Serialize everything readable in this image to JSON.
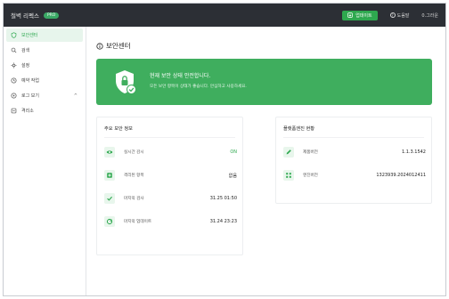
{
  "app": {
    "title": "철벽 리펙스",
    "badge": "PRO"
  },
  "topbar": {
    "update_label": "업데이트",
    "help_label": "도움말",
    "version_label": "0.그라운"
  },
  "sidebar": {
    "items": [
      {
        "label": "보안센터",
        "icon": "shield-icon",
        "active": true
      },
      {
        "label": "검색",
        "icon": "search-icon",
        "active": false
      },
      {
        "label": "설정",
        "icon": "gear-icon",
        "active": false
      },
      {
        "label": "예약 작업",
        "icon": "clock-icon",
        "active": false
      },
      {
        "label": "로그 보기",
        "icon": "log-icon",
        "active": false,
        "expandable": true
      },
      {
        "label": "격리소",
        "icon": "quarantine-icon",
        "active": false
      }
    ]
  },
  "main": {
    "title": "보안센터",
    "banner": {
      "title": "현재 보안 상태 안전합니다.",
      "description": "모든 보안 항목이 상태가 좋습니다. 안심하고 사용하세요."
    },
    "status_card": {
      "title": "주요 보안 정보",
      "rows": [
        {
          "icon": "eye-icon",
          "label": "실시간 감시",
          "value": "ON",
          "green": true
        },
        {
          "icon": "plus-icon",
          "label": "격리된 항목",
          "value": "없음",
          "green": false
        },
        {
          "icon": "check-icon",
          "label": "마지막 검사",
          "value": "31.25 01:50",
          "green": false
        },
        {
          "icon": "refresh-icon",
          "label": "마지막 업데이트",
          "value": "31.24 23:23",
          "green": false
        }
      ]
    },
    "engine_card": {
      "title": "플랫폼엔진 현황",
      "rows": [
        {
          "icon": "pen-icon",
          "label": "제품버전",
          "value": "1.1.3.1542"
        },
        {
          "icon": "grid-icon",
          "label": "엔진버전",
          "value": "1323939.2024012411"
        }
      ]
    }
  },
  "colors": {
    "accent": "#2ea84f",
    "banner": "#3fae5e",
    "topbar": "#2c2f35"
  }
}
